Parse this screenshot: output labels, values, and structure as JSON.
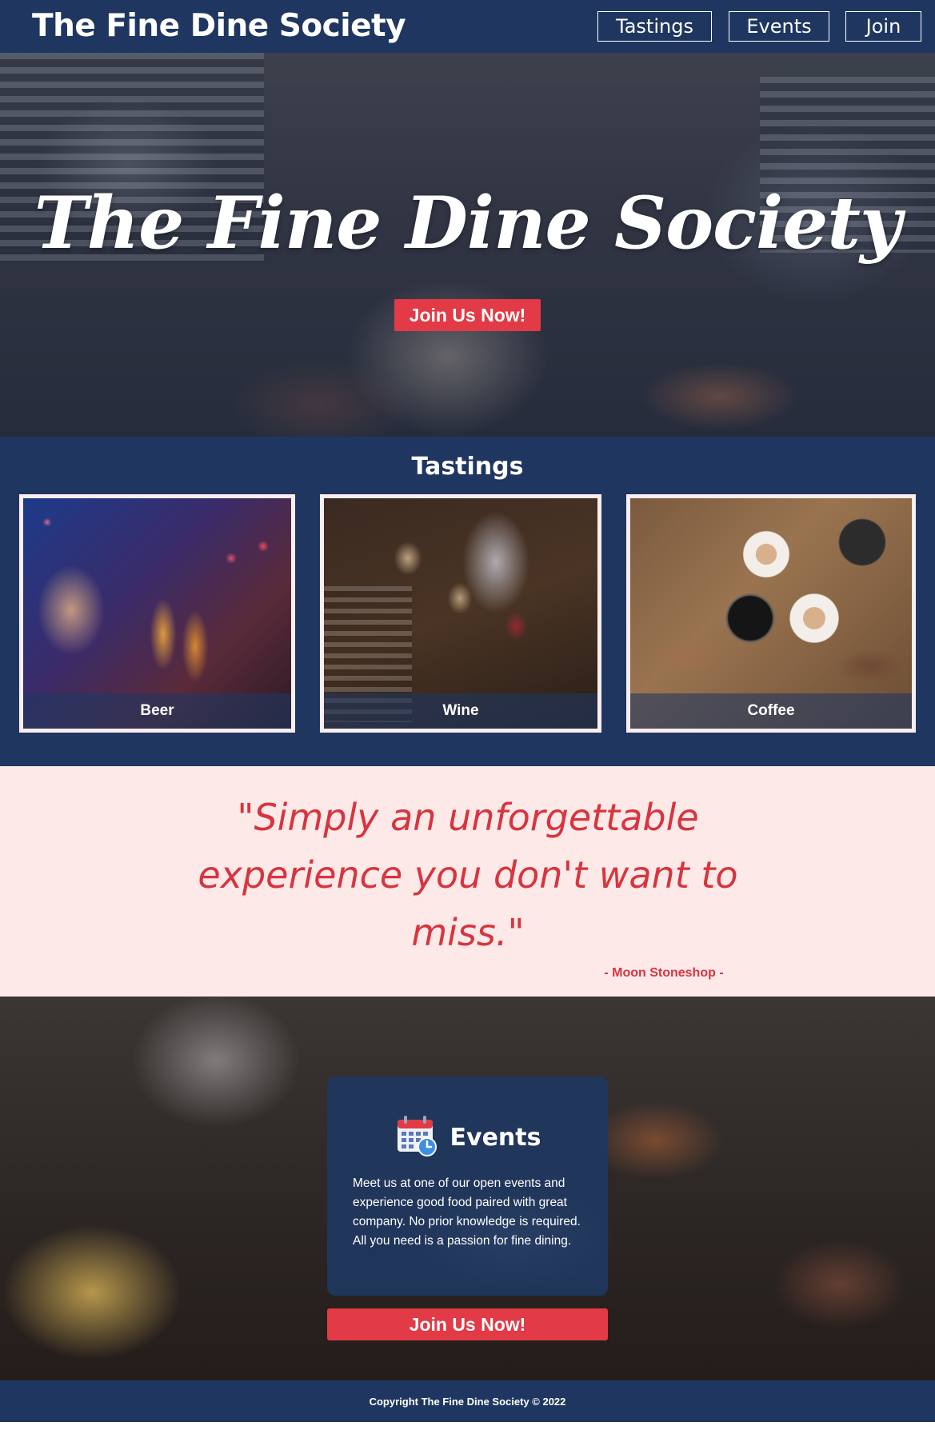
{
  "nav": {
    "brand": "The Fine Dine Society",
    "links": [
      "Tastings",
      "Events",
      "Join"
    ]
  },
  "hero": {
    "title": "The Fine Dine Society",
    "cta": "Join Us Now!"
  },
  "tastings": {
    "title": "Tastings",
    "cards": [
      {
        "label": "Beer"
      },
      {
        "label": "Wine"
      },
      {
        "label": "Coffee"
      }
    ]
  },
  "quote": {
    "text": "\"Simply an unforgettable experience you don't want to miss.\"",
    "author": "- Moon Stoneshop -"
  },
  "events": {
    "icon": "calendar-clock-icon",
    "title": "Events",
    "body": "Meet us at one of our open events and experience good food paired with great company. No prior knowledge is required. All you need is a passion for fine dining.",
    "cta": "Join Us Now!"
  },
  "footer": {
    "copyright": "Copyright The Fine Dine Society © 2022"
  },
  "colors": {
    "navy": "#1f3760",
    "accent_red": "#e23a46",
    "quote_bg": "#fde9e8",
    "quote_text": "#d8343f"
  }
}
